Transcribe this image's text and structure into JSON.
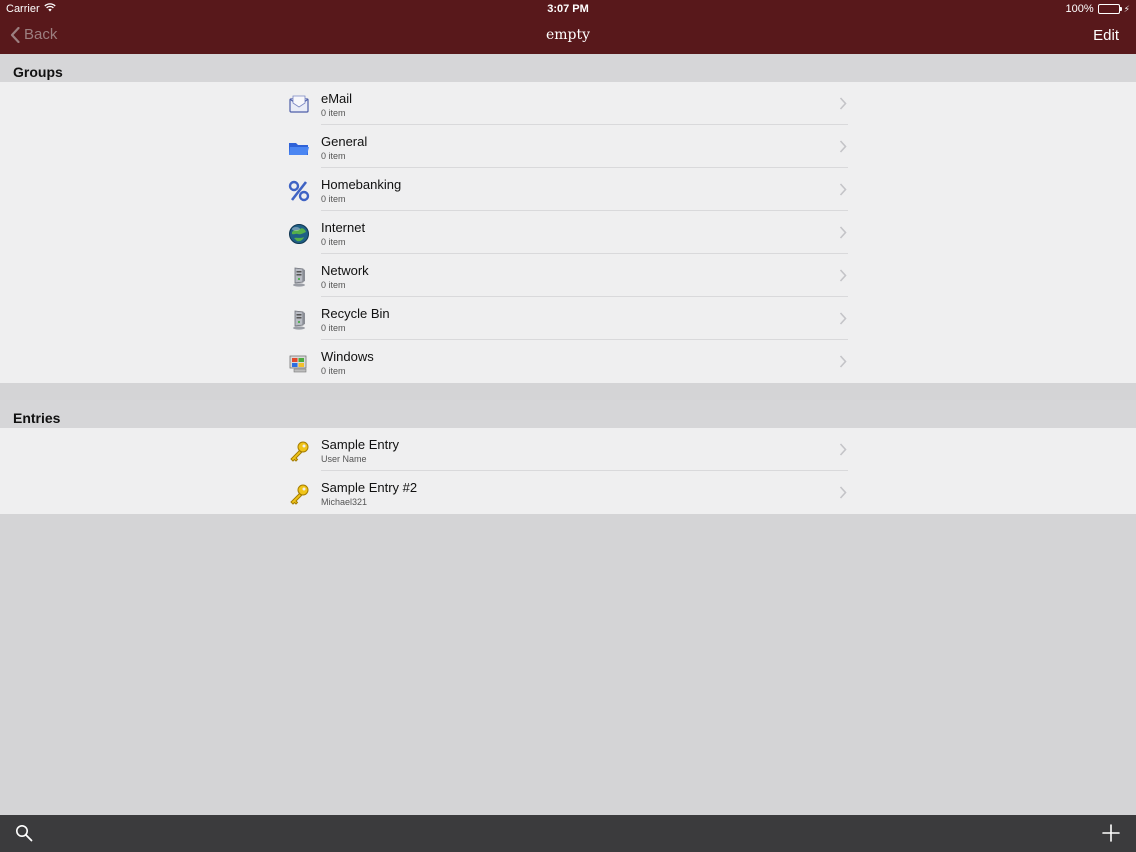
{
  "status": {
    "carrier": "Carrier",
    "time": "3:07 PM",
    "battery": "100%"
  },
  "nav": {
    "back_label": "Back",
    "title": "empty",
    "edit_label": "Edit"
  },
  "groups": {
    "header": "Groups",
    "items": [
      {
        "title": "eMail",
        "subtitle": "0 item",
        "icon": "email-icon"
      },
      {
        "title": "General",
        "subtitle": "0 item",
        "icon": "folder-icon"
      },
      {
        "title": "Homebanking",
        "subtitle": "0 item",
        "icon": "percent-icon"
      },
      {
        "title": "Internet",
        "subtitle": "0 item",
        "icon": "globe-icon"
      },
      {
        "title": "Network",
        "subtitle": "0 item",
        "icon": "server-icon"
      },
      {
        "title": "Recycle Bin",
        "subtitle": "0 item",
        "icon": "server-icon"
      },
      {
        "title": "Windows",
        "subtitle": "0 item",
        "icon": "windows-icon"
      }
    ]
  },
  "entries": {
    "header": "Entries",
    "items": [
      {
        "title": "Sample Entry",
        "subtitle": "User Name",
        "icon": "key-icon"
      },
      {
        "title": "Sample Entry #2",
        "subtitle": "Michael321",
        "icon": "key-icon"
      }
    ]
  },
  "colors": {
    "nav_background": "#58181b",
    "toolbar_background": "#3b3b3d",
    "battery_fill": "#4cd964",
    "list_background": "#efeff0",
    "page_background": "#d4d4d6"
  }
}
